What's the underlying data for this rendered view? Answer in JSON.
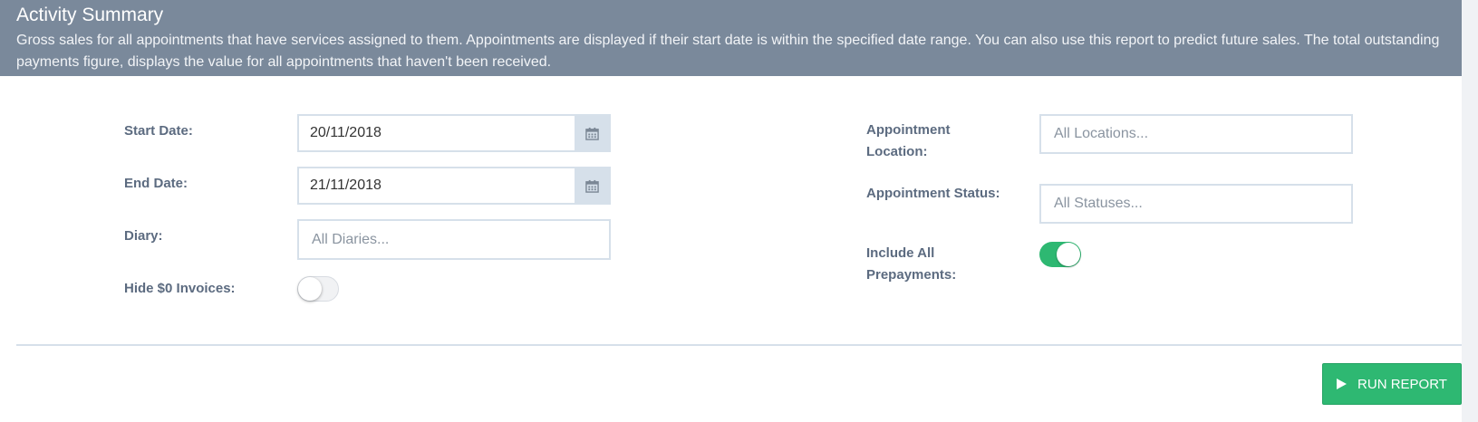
{
  "header": {
    "title": "Activity Summary",
    "description": "Gross sales for all appointments that have services assigned to them. Appointments are displayed if their start date is within the specified date range. You can also use this report to predict future sales. The total outstanding payments figure, displays the value for all appointments that haven't been received."
  },
  "form": {
    "start_date_label": "Start Date:",
    "start_date_value": "20/11/2018",
    "end_date_label": "End Date:",
    "end_date_value": "21/11/2018",
    "diary_label": "Diary:",
    "diary_placeholder": "All Diaries...",
    "hide_zero_label": "Hide $0 Invoices:",
    "hide_zero_on": false,
    "location_label_line1": "Appointment",
    "location_label_line2": "Location:",
    "location_placeholder": "All Locations...",
    "status_label": "Appointment Status:",
    "status_placeholder": "All Statuses...",
    "prepay_label_line1": "Include All",
    "prepay_label_line2": "Prepayments:",
    "prepay_on": true
  },
  "actions": {
    "run_label": "RUN REPORT"
  },
  "colors": {
    "header_bg": "#7a899b",
    "accent_green": "#2eb872",
    "label_text": "#5c6b80"
  }
}
